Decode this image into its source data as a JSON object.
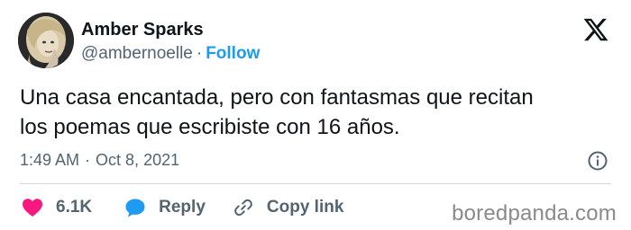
{
  "author": {
    "name": "Amber Sparks",
    "handle": "@ambernoelle",
    "separator": "·",
    "follow_label": "Follow"
  },
  "tweet": {
    "lines": [
      "Una casa encantada, pero con fantasmas que recitan",
      "los poemas que escribiste con 16 años."
    ],
    "time": "1:49 AM",
    "separator": "·",
    "date": "Oct 8, 2021"
  },
  "actions": {
    "likes": "6.1K",
    "reply_label": "Reply",
    "copy_label": "Copy link"
  },
  "icons": {
    "logo": "x-logo-icon",
    "info": "info-icon",
    "like": "heart-icon",
    "reply": "speech-bubble-icon",
    "copy": "link-icon"
  },
  "colors": {
    "like": "#f91880",
    "reply": "#1d9bf0",
    "follow": "#1d9bf0",
    "muted": "#536471"
  },
  "watermark": "boredpanda.com"
}
